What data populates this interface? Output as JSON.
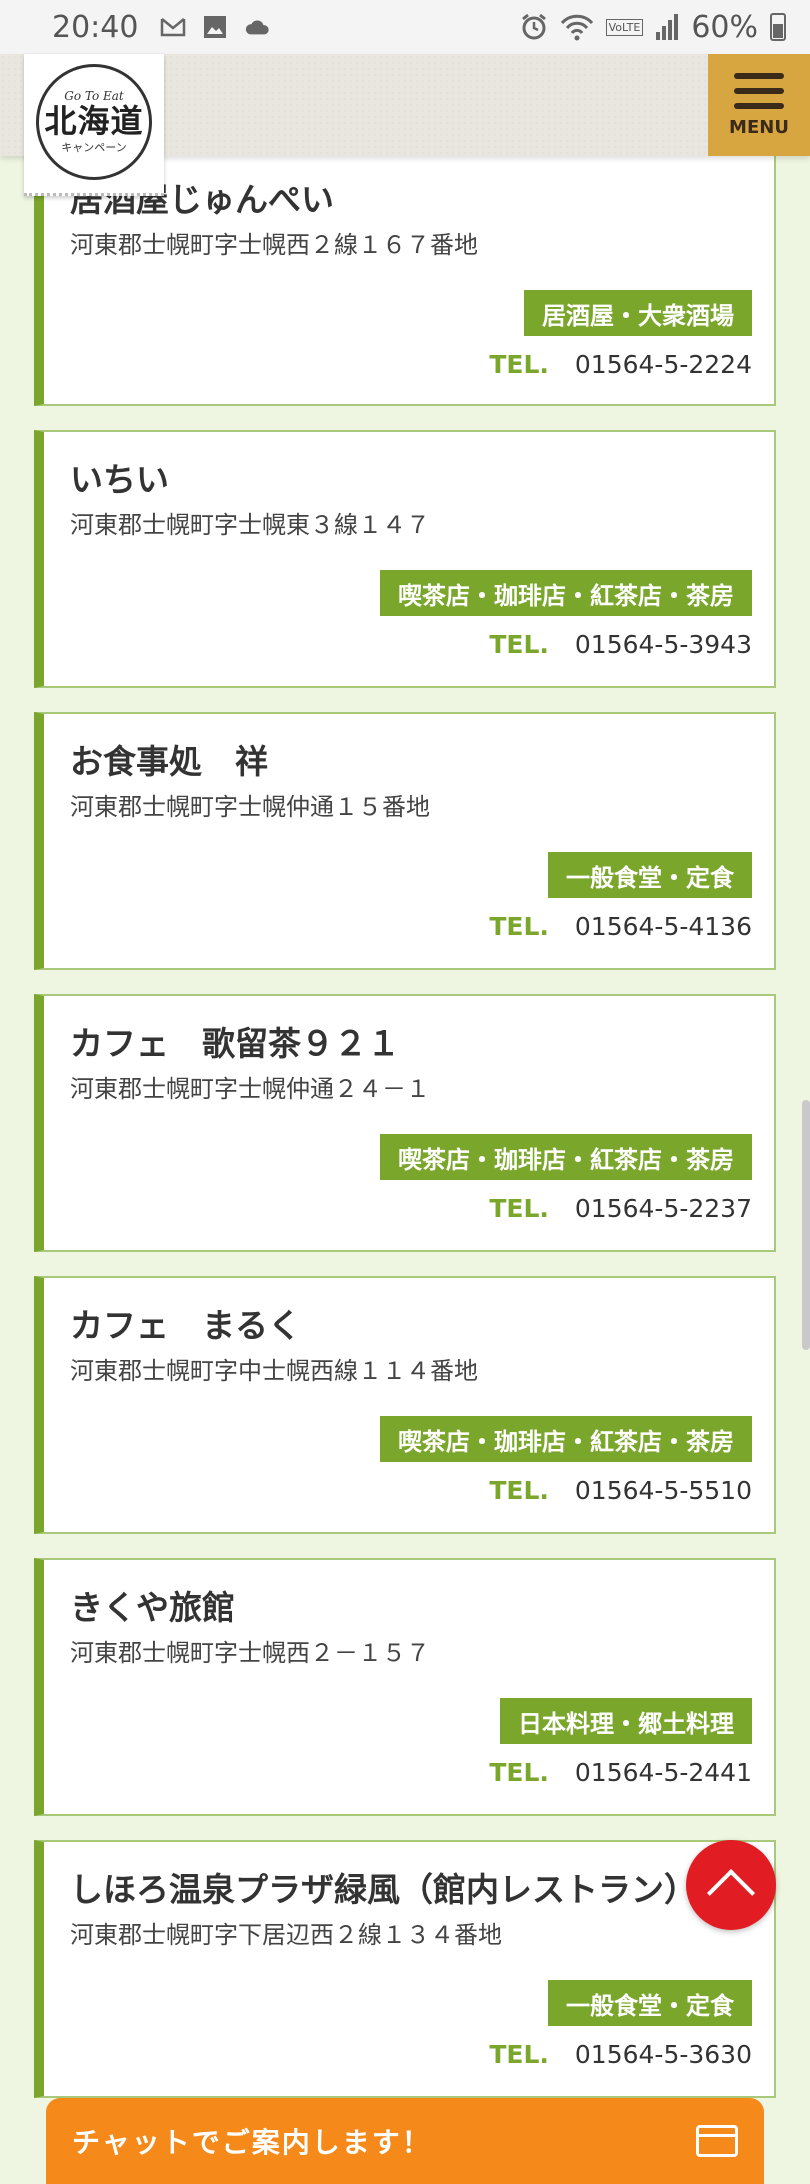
{
  "status_bar": {
    "time": "20:40",
    "battery": "60%",
    "icons": [
      "gmail-icon",
      "image-icon",
      "cloud-icon",
      "alarm-icon",
      "wifi-icon",
      "volte-icon",
      "signal-icon",
      "battery-icon"
    ],
    "volte": "VoLTE"
  },
  "header": {
    "logo_top": "Go To Eat",
    "logo_main": "北海道",
    "logo_bottom": "キャンペーン",
    "menu_label": "MENU"
  },
  "tel_label": "TEL.",
  "cards": [
    {
      "name": "居酒屋じゅんぺい",
      "address": "河東郡士幌町字士幌西２線１６７番地",
      "category": "居酒屋・大衆酒場",
      "tel": "01564-5-2224"
    },
    {
      "name": "いちい",
      "address": "河東郡士幌町字士幌東３線１４７",
      "category": "喫茶店・珈琲店・紅茶店・茶房",
      "tel": "01564-5-3943"
    },
    {
      "name": "お食事処　祥",
      "address": "河東郡士幌町字士幌仲通１５番地",
      "category": "一般食堂・定食",
      "tel": "01564-5-4136"
    },
    {
      "name": "カフェ　歌留茶９２１",
      "address": "河東郡士幌町字士幌仲通２４－１",
      "category": "喫茶店・珈琲店・紅茶店・茶房",
      "tel": "01564-5-2237"
    },
    {
      "name": "カフェ　まるく",
      "address": "河東郡士幌町字中士幌西線１１４番地",
      "category": "喫茶店・珈琲店・紅茶店・茶房",
      "tel": "01564-5-5510"
    },
    {
      "name": "きくや旅館",
      "address": "河東郡士幌町字士幌西２－１５７",
      "category": "日本料理・郷土料理",
      "tel": "01564-5-2441"
    },
    {
      "name": "しほろ温泉プラザ緑風（館内レストラン）",
      "address": "河東郡士幌町字下居辺西２線１３４番地",
      "category": "一般食堂・定食",
      "tel": "01564-5-3630"
    }
  ],
  "chat": {
    "text": "チャットでご案内します！"
  }
}
